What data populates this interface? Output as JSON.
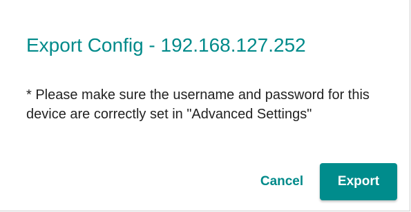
{
  "dialog": {
    "title": "Export Config - 192.168.127.252",
    "message": "* Please make sure the username and password for this device are correctly set in \"Advanced Settings\"",
    "cancel_label": "Cancel",
    "export_label": "Export"
  },
  "colors": {
    "accent": "#008a8a",
    "text": "#222222",
    "button_bg": "#008c8c",
    "button_text": "#ffffff"
  }
}
